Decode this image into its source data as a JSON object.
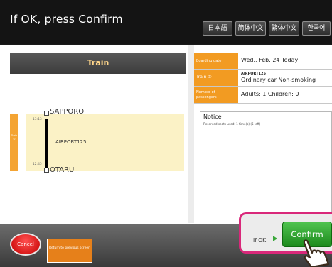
{
  "header": {
    "title": "If OK, press Confirm",
    "languages": [
      "日本語",
      "简体中文",
      "繁体中文",
      "한국어"
    ]
  },
  "train_panel": {
    "header": "Train",
    "side_tab": "Train ①",
    "departure": {
      "time": "13:13",
      "station": "SAPPORO"
    },
    "train_name": "AIRPORT125",
    "arrival": {
      "time": "12:45",
      "station": "OTARU"
    }
  },
  "details": {
    "boarding_date_label": "Boarding date",
    "boarding_date": "Wed., Feb. 24  Today",
    "train_label": "Train ①",
    "train_name": "AIRPORT125",
    "car_type": "Ordinary car   Non-smoking",
    "passengers_label": "Number of passengers",
    "passengers": "Adults: 1  Children: 0"
  },
  "notice": {
    "title": "Notice",
    "text": "Reserved seats used: 1 time(s) (5 left)"
  },
  "footer": {
    "cancel": "Cancel",
    "back": "Return to previous screen",
    "if_ok": "If OK",
    "confirm": "Confirm"
  },
  "colors": {
    "accent_orange": "#f29b22",
    "confirm_green": "#2ea52e",
    "highlight_pink": "#d9287a"
  }
}
